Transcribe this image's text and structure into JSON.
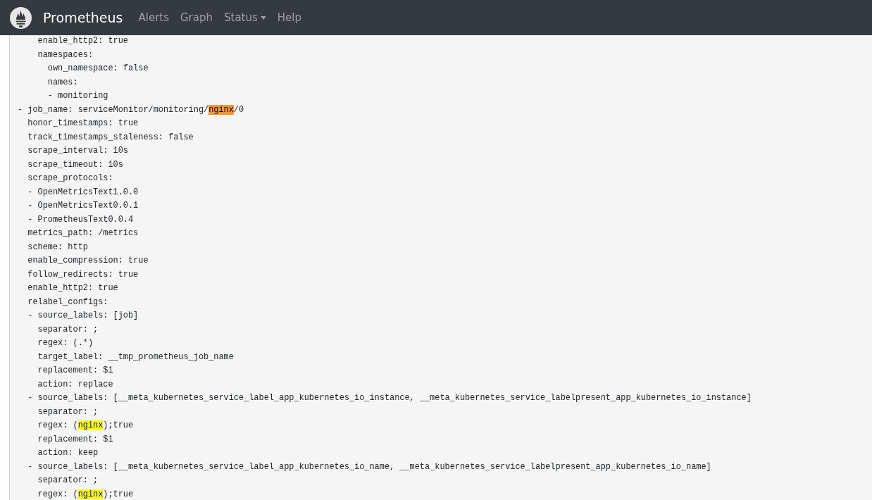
{
  "navbar": {
    "brand": "Prometheus",
    "links": [
      {
        "label": "Alerts",
        "dropdown": false
      },
      {
        "label": "Graph",
        "dropdown": false
      },
      {
        "label": "Status",
        "dropdown": true
      },
      {
        "label": "Help",
        "dropdown": false
      }
    ]
  },
  "config_lines": [
    [
      {
        "text": "    enable_http2: true",
        "highlighted": false,
        "selected": false
      }
    ],
    [
      {
        "text": "    namespaces:",
        "highlighted": false,
        "selected": false
      }
    ],
    [
      {
        "text": "      own_namespace: false",
        "highlighted": false,
        "selected": false
      }
    ],
    [
      {
        "text": "      names:",
        "highlighted": false,
        "selected": false
      }
    ],
    [
      {
        "text": "      - monitoring",
        "highlighted": false,
        "selected": false
      }
    ],
    [
      {
        "text": "- job_name: serviceMonitor/monitoring/",
        "highlighted": false,
        "selected": false
      },
      {
        "text": "nginx",
        "highlighted": true,
        "selected": true
      },
      {
        "text": "/0",
        "highlighted": false,
        "selected": false
      }
    ],
    [
      {
        "text": "  honor_timestamps: true",
        "highlighted": false,
        "selected": false
      }
    ],
    [
      {
        "text": "  track_timestamps_staleness: false",
        "highlighted": false,
        "selected": false
      }
    ],
    [
      {
        "text": "  scrape_interval: 10s",
        "highlighted": false,
        "selected": false
      }
    ],
    [
      {
        "text": "  scrape_timeout: 10s",
        "highlighted": false,
        "selected": false
      }
    ],
    [
      {
        "text": "  scrape_protocols:",
        "highlighted": false,
        "selected": false
      }
    ],
    [
      {
        "text": "  - OpenMetricsText1.0.0",
        "highlighted": false,
        "selected": false
      }
    ],
    [
      {
        "text": "  - OpenMetricsText0.0.1",
        "highlighted": false,
        "selected": false
      }
    ],
    [
      {
        "text": "  - PrometheusText0.0.4",
        "highlighted": false,
        "selected": false
      }
    ],
    [
      {
        "text": "  metrics_path: /metrics",
        "highlighted": false,
        "selected": false
      }
    ],
    [
      {
        "text": "  scheme: http",
        "highlighted": false,
        "selected": false
      }
    ],
    [
      {
        "text": "  enable_compression: true",
        "highlighted": false,
        "selected": false
      }
    ],
    [
      {
        "text": "  follow_redirects: true",
        "highlighted": false,
        "selected": false
      }
    ],
    [
      {
        "text": "  enable_http2: true",
        "highlighted": false,
        "selected": false
      }
    ],
    [
      {
        "text": "  relabel_configs:",
        "highlighted": false,
        "selected": false
      }
    ],
    [
      {
        "text": "  - source_labels: [job]",
        "highlighted": false,
        "selected": false
      }
    ],
    [
      {
        "text": "    separator: ;",
        "highlighted": false,
        "selected": false
      }
    ],
    [
      {
        "text": "    regex: (.*)",
        "highlighted": false,
        "selected": false
      }
    ],
    [
      {
        "text": "    target_label: __tmp_prometheus_job_name",
        "highlighted": false,
        "selected": false
      }
    ],
    [
      {
        "text": "    replacement: $1",
        "highlighted": false,
        "selected": false
      }
    ],
    [
      {
        "text": "    action: replace",
        "highlighted": false,
        "selected": false
      }
    ],
    [
      {
        "text": "  - source_labels: [__meta_kubernetes_service_label_app_kubernetes_io_instance, __meta_kubernetes_service_labelpresent_app_kubernetes_io_instance]",
        "highlighted": false,
        "selected": false
      }
    ],
    [
      {
        "text": "    separator: ;",
        "highlighted": false,
        "selected": false
      }
    ],
    [
      {
        "text": "    regex: (",
        "highlighted": false,
        "selected": false
      },
      {
        "text": "nginx",
        "highlighted": true,
        "selected": false
      },
      {
        "text": ");true",
        "highlighted": false,
        "selected": false
      }
    ],
    [
      {
        "text": "    replacement: $1",
        "highlighted": false,
        "selected": false
      }
    ],
    [
      {
        "text": "    action: keep",
        "highlighted": false,
        "selected": false
      }
    ],
    [
      {
        "text": "  - source_labels: [__meta_kubernetes_service_label_app_kubernetes_io_name, __meta_kubernetes_service_labelpresent_app_kubernetes_io_name]",
        "highlighted": false,
        "selected": false
      }
    ],
    [
      {
        "text": "    separator: ;",
        "highlighted": false,
        "selected": false
      }
    ],
    [
      {
        "text": "    regex: (",
        "highlighted": false,
        "selected": false
      },
      {
        "text": "nginx",
        "highlighted": true,
        "selected": false
      },
      {
        "text": ");true",
        "highlighted": false,
        "selected": false
      }
    ]
  ]
}
